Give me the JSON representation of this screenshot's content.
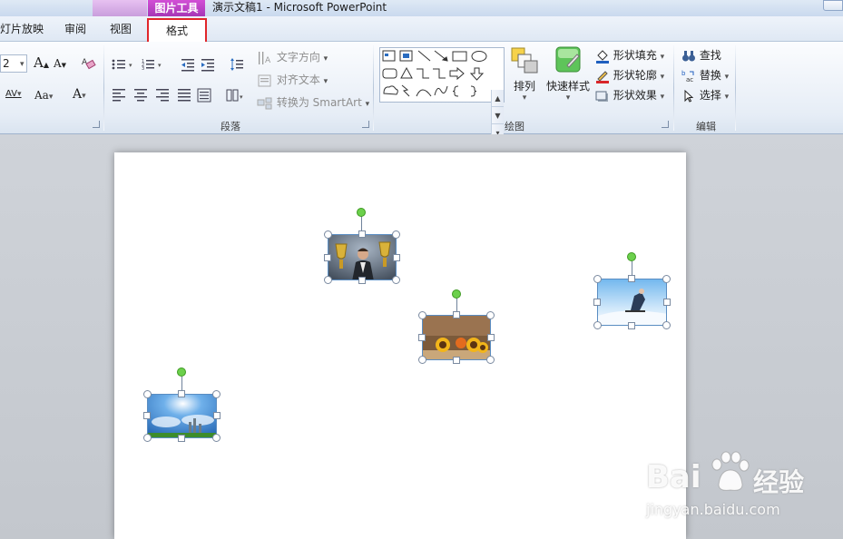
{
  "titlebar": {
    "context_group": "图片工具",
    "title": "演示文稿1  -  Microsoft PowerPoint"
  },
  "tabs": [
    {
      "label": "灯片放映"
    },
    {
      "label": "审阅"
    },
    {
      "label": "视图"
    },
    {
      "label": "格式",
      "highlighted": true
    }
  ],
  "ribbon": {
    "font": {
      "size_value": "2",
      "grow_icon": "A",
      "shrink_icon": "A",
      "spacing_label": "AV",
      "case_label": "Aa",
      "color_label": "A"
    },
    "paragraph": {
      "group_label": "段落",
      "text_direction": "文字方向",
      "align_text": "对齐文本",
      "smartart": "转换为 SmartArt"
    },
    "drawing": {
      "group_label": "绘图",
      "arrange": "排列",
      "quick_styles": "快速样式",
      "shape_fill": "形状填充",
      "shape_outline": "形状轮廓",
      "shape_effects": "形状效果"
    },
    "editing": {
      "group_label": "编辑",
      "find": "查找",
      "replace": "替换",
      "select": "选择"
    }
  },
  "watermark": {
    "brand": "Bai",
    "brand_cn": "经验",
    "url": "jingyan.baidu.com"
  },
  "colors": {
    "accent_red": "#e0262a",
    "context_magenta": "#c245c8",
    "rotation_handle": "#6cd04c"
  }
}
